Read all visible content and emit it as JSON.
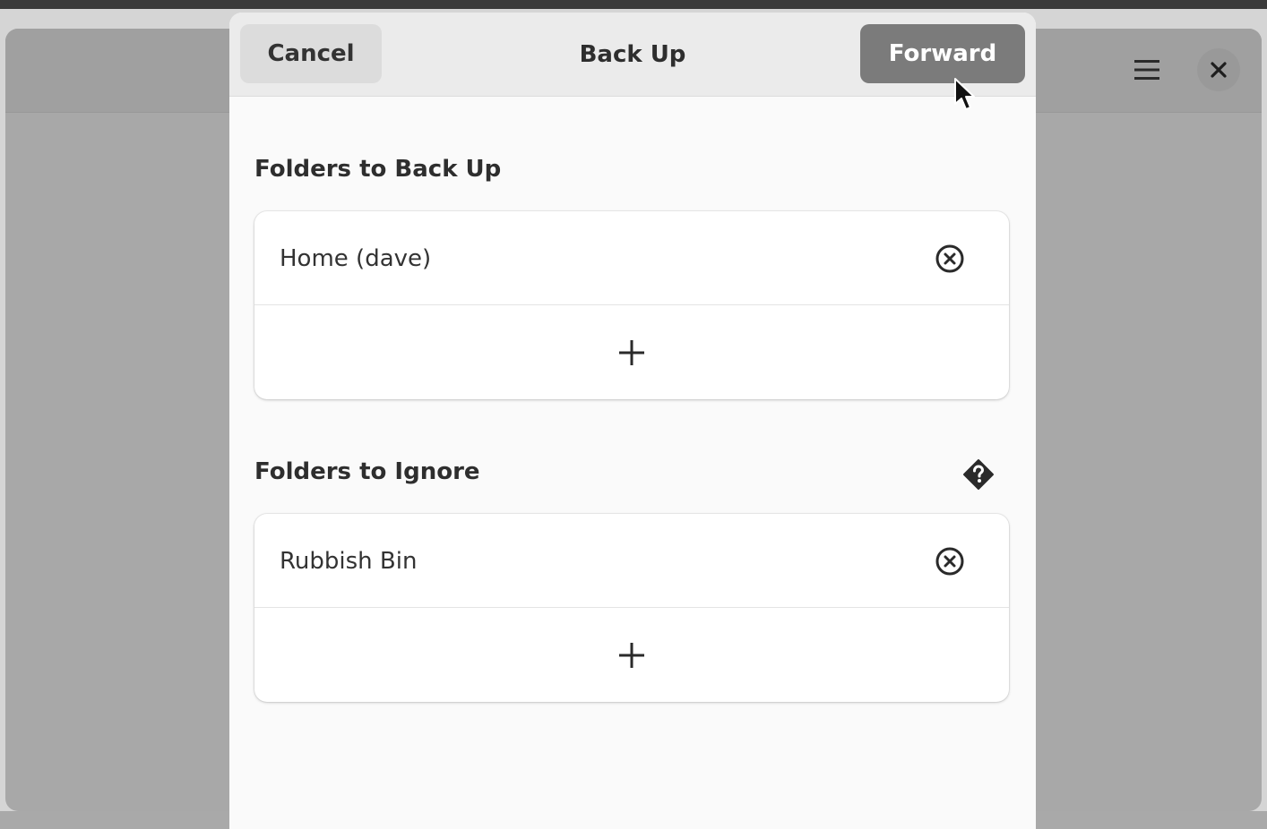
{
  "background_window": {
    "menu_icon": "hamburger-menu-icon",
    "close_icon": "close-icon"
  },
  "dialog": {
    "title": "Back Up",
    "cancel_label": "Cancel",
    "forward_label": "Forward"
  },
  "sections": [
    {
      "title": "Folders to Back Up",
      "items": [
        {
          "label": "Home (dave)",
          "action_icon": "remove-circle-icon"
        }
      ],
      "add_icon": "plus-icon"
    },
    {
      "title": "Folders to Ignore",
      "help_icon": "help-diamond-icon",
      "items": [
        {
          "label": "Rubbish Bin",
          "action_icon": "remove-circle-icon"
        }
      ],
      "add_icon": "plus-icon"
    }
  ],
  "colors": {
    "forward_button": "#7b7b7b",
    "dialog_background": "#fafafa",
    "header_background": "#ebebeb",
    "dimmed_window": "#a8a8a8"
  }
}
